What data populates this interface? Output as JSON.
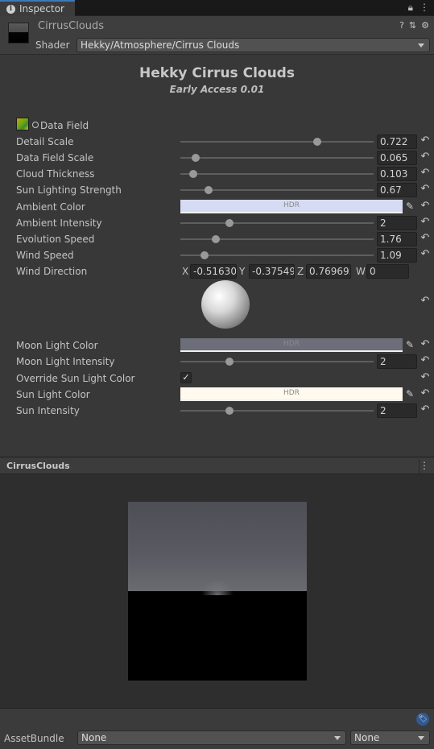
{
  "tab": {
    "label": "Inspector",
    "icon": "info-icon"
  },
  "tab_actions": {
    "lock": "🔒",
    "menu": "⋮"
  },
  "header": {
    "material_name": "CirrusClouds",
    "shader_label": "Shader",
    "shader_value": "Hekky/Atmosphere/Cirrus Clouds",
    "icons": [
      "help-icon",
      "preset-icon",
      "settings-icon"
    ]
  },
  "main": {
    "title": "Hekky Cirrus Clouds",
    "subtitle": "Early Access 0.01",
    "texture": {
      "label": "Data Field"
    },
    "sliders": [
      {
        "label": "Detail Scale",
        "value": "0.722",
        "fraction": 0.71
      },
      {
        "label": "Data Field Scale",
        "value": "0.065",
        "fraction": 0.08
      },
      {
        "label": "Cloud Thickness",
        "value": "0.103",
        "fraction": 0.065
      },
      {
        "label": "Sun Lighting Strength",
        "value": "0.67",
        "fraction": 0.145
      }
    ],
    "ambient_color": {
      "label": "Ambient Color",
      "hdr": "HDR",
      "color": "#d6dbf4"
    },
    "sliders2": [
      {
        "label": "Ambient Intensity",
        "value": "2",
        "fraction": 0.255
      },
      {
        "label": "Evolution Speed",
        "value": "1.76",
        "fraction": 0.185
      },
      {
        "label": "Wind Speed",
        "value": "1.09",
        "fraction": 0.125
      }
    ],
    "wind_direction": {
      "label": "Wind Direction",
      "x_label": "X",
      "x": "-0.51630",
      "y_label": "Y",
      "y": "-0.37549",
      "z_label": "Z",
      "z": "0.769695",
      "w_label": "W",
      "w": "0"
    },
    "moon_color": {
      "label": "Moon Light Color",
      "hdr": "HDR",
      "color": "#6c6e7a"
    },
    "moon_intensity": {
      "label": "Moon Light Intensity",
      "value": "2",
      "fraction": 0.255
    },
    "override_sun": {
      "label": "Override Sun Light Color",
      "checked": "✓"
    },
    "sun_color": {
      "label": "Sun Light Color",
      "hdr": "HDR",
      "color": "#fff9ee"
    },
    "sun_intensity": {
      "label": "Sun Intensity",
      "value": "2",
      "fraction": 0.255
    }
  },
  "preview": {
    "title": "CirrusClouds",
    "menu": "⋮"
  },
  "footer": {
    "assetbundle_label": "AssetBundle",
    "bundle_value": "None",
    "variant_value": "None"
  }
}
